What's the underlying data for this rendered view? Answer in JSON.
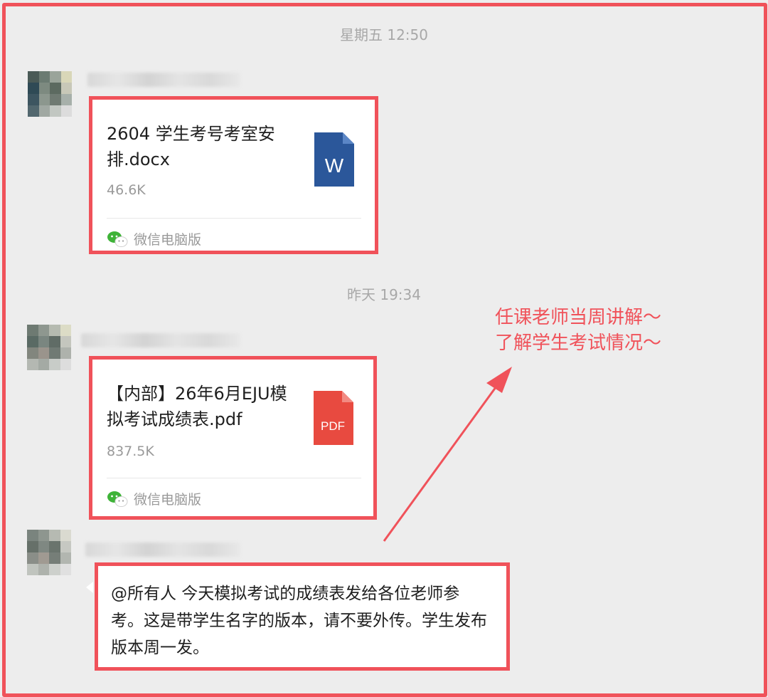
{
  "messages": [
    {
      "timestamp": "星期五 12:50",
      "file": {
        "name": "2604 学生考号考室安排.docx",
        "size": "46.6K",
        "icon": "word-doc-icon",
        "icon_label": "W",
        "icon_color": "#2b579a"
      },
      "source_label": "微信电脑版"
    },
    {
      "timestamp": "昨天 19:34",
      "file": {
        "name": "【内部】26年6月EJU模拟考试成绩表.pdf",
        "size": "837.5K",
        "icon": "pdf-icon",
        "icon_label": "PDF",
        "icon_color": "#e84a40"
      },
      "source_label": "微信电脑版"
    },
    {
      "text": "@所有人 今天模拟考试的成绩表发给各位老师参考。这是带学生名字的版本，请不要外传。学生发布版本周一发。"
    }
  ],
  "annotation": {
    "line1": "任课老师当周讲解～",
    "line2": "了解学生考试情况～",
    "color": "#f0525a"
  },
  "colors": {
    "background": "#ededed",
    "highlight": "#f0525a",
    "wechat_green": "#3fb338"
  }
}
